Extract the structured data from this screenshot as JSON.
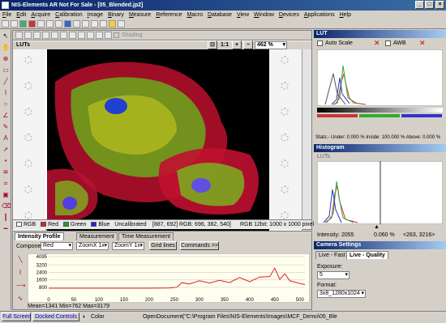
{
  "window": {
    "title": "NIS-Elements AR Not For Sale - [05_Blended.jp2]"
  },
  "menu": [
    "File",
    "Edit",
    "Acquire",
    "Calibration",
    "Image",
    "Binary",
    "Measure",
    "Reference",
    "Macro",
    "Database",
    "View",
    "Window",
    "Devices",
    "Applications",
    "Help"
  ],
  "image_window": {
    "zoom_buttons": [
      "1:1",
      "1:1"
    ],
    "zoom": "462 %",
    "shading": "Shading",
    "luts_label": "LUTs",
    "channels": [
      {
        "label": "RGB",
        "color": "#ffffff"
      },
      {
        "label": "Red",
        "color": "#e02020"
      },
      {
        "label": "Green",
        "color": "#20a020"
      },
      {
        "label": "Blue",
        "color": "#2020e0"
      }
    ],
    "calibration": "Uncalibrated",
    "cursor": "[887, 692]",
    "rgb_value": "RGB: 696, 382, 540]",
    "format": "RGB 12bit: 1000 x 1000 pixels"
  },
  "intensity_panel": {
    "tabs": [
      "Intensity Profile",
      "Measurement",
      "Time Measurement"
    ],
    "component_label": "Component:",
    "component_value": "Red",
    "zoom_x": "ZoomX 1x",
    "zoom_y": "ZoomY 1x",
    "grid_button": "Grid lines",
    "commands_button": "Commands >>",
    "stats": "Mean=1341  Min=762  Max=3179"
  },
  "chart_data": {
    "type": "line",
    "ylim": [
      0,
      4095
    ],
    "yticks": [
      4095,
      3200,
      2400,
      1600,
      800
    ],
    "xticks": [
      0,
      50,
      100,
      150,
      200,
      250,
      300,
      350,
      400,
      450,
      500
    ],
    "xlim": [
      0,
      510
    ],
    "series": [
      {
        "x": [
          0,
          50,
          100,
          150,
          200,
          240,
          255,
          265,
          280,
          300,
          320,
          340,
          360,
          380,
          400,
          420,
          440,
          450,
          460,
          470,
          480,
          500,
          510
        ],
        "values": [
          700,
          700,
          700,
          700,
          700,
          720,
          800,
          1300,
          1150,
          1500,
          1250,
          1550,
          1300,
          1850,
          1400,
          1900,
          1950,
          2850,
          1650,
          2250,
          1500,
          1200,
          1100
        ],
        "color": "#e02020"
      }
    ]
  },
  "lut_panel": {
    "title": "LUT",
    "auto_scale": "Auto Scale",
    "awb": "AWB",
    "stats": "Stats:- Under: 0.000 %  Inside: 100.000 %  Above: 0.000 %"
  },
  "histogram_panel": {
    "title": "Histogram",
    "luts": "LUTs",
    "intensity": "Intensity: 2055",
    "percent": "0.060 %",
    "range": "<263, 3216>"
  },
  "camera_panel": {
    "title": "Camera Settings",
    "tabs": [
      "Live - Fast",
      "Live - Quality"
    ],
    "exposure_label": "Exposure:",
    "exposure_value": "5",
    "format_label": "Format:",
    "format_value": "3x8_1280x1024"
  },
  "statusbar": {
    "full_screen": "Full Screen",
    "docked": "Docked Controls",
    "color": "Color",
    "path": "OpenDocument(\"C:\\Program Files\\NIS-Elements\\Images\\MCF_Demo\\05_Ble"
  }
}
